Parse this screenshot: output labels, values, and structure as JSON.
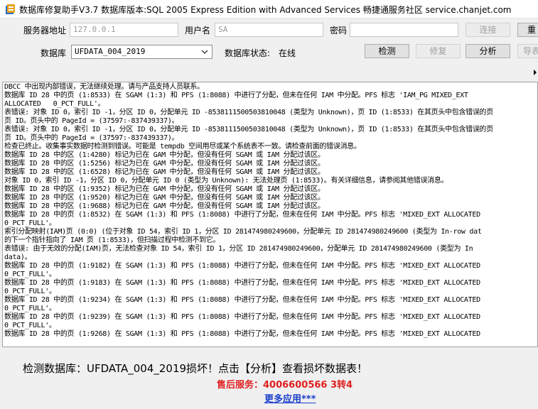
{
  "window": {
    "title": "数据库修复助手V3.7 数据库版本:SQL 2005 Express Edition with Advanced Services 畅捷通服务社区 service.chanjet.com"
  },
  "form": {
    "server_label": "服务器地址",
    "server_value": "127.0.0.1",
    "user_label": "用户名",
    "user_value": "SA",
    "password_label": "密码",
    "password_value": "",
    "database_label": "数据库",
    "database_selected": "UFDATA_004_2019",
    "db_status_label": "数据库状态:",
    "db_status_value": "在线"
  },
  "buttons": {
    "connect": "连接",
    "reconnect": "重",
    "check": "检测",
    "repair": "修复",
    "analyze": "分析",
    "export": "导表"
  },
  "log": {
    "lines": [
      "DBCC 中出现内部错误，无法继续处理。请与产品支持人员联系。",
      "数据库 ID 28 中的页 (1:8533) 在 SGAM (1:3) 和 PFS (1:8088) 中进行了分配，但未在任何 IAM 中分配。PFS 标志 'IAM_PG MIXED_EXT",
      "ALLOCATED   0_PCT_FULL'。",
      "表错误: 对象 ID 0，索引 ID -1，分区 ID 0，分配单元 ID -8538111500503810048 (类型为 Unknown)，页 ID (1:8533) 在其页头中包含错误的页",
      "页 ID。页头中的 PageId = (37597:-837439337)。",
      "表错误: 对象 ID 0，索引 ID -1，分区 ID 0，分配单元 ID -8538111500503810048 (类型为 Unknown)，页 ID (1:8533) 在其页头中包含错误的页",
      "页 ID。页头中的 PageId = (37597:-837439337)。",
      "检查已终止。收集事实数据时检测到错误。可能是 tempdb 空间用尽或某个系统表不一致。请检查前面的错误消息。",
      "数据库 ID 28 中的区 (1:4280) 标记为已在 GAM 中分配，但没有任何 SGAM 或 IAM 分配过该区。",
      "数据库 ID 28 中的区 (1:5256) 标记为已在 GAM 中分配，但没有任何 SGAM 或 IAM 分配过该区。",
      "数据库 ID 28 中的区 (1:6528) 标记为已在 GAM 中分配，但没有任何 SGAM 或 IAM 分配过该区。",
      "对象 ID 0，索引 ID -1，分区 ID 0，分配单元 ID 0 (类型为 Unknown): 无法处理页 (1:8533)。有关详细信息，请参阅其他错误消息。",
      "数据库 ID 28 中的区 (1:9352) 标记为已在 GAM 中分配，但没有任何 SGAM 或 IAM 分配过该区。",
      "数据库 ID 28 中的区 (1:9520) 标记为已在 GAM 中分配，但没有任何 SGAM 或 IAM 分配过该区。",
      "数据库 ID 28 中的区 (1:9688) 标记为已在 GAM 中分配，但没有任何 SGAM 或 IAM 分配过该区。",
      "数据库 ID 28 中的页 (1:8532) 在 SGAM (1:3) 和 PFS (1:8088) 中进行了分配，但未在任何 IAM 中分配。PFS 标志 'MIXED_EXT ALLOCATED",
      "0_PCT_FULL'。",
      "索引分配映射(IAM)页 (0:0) (位于对象 ID 54，索引 ID 1，分区 ID 281474980249600，分配单元 ID 281474980249600 (类型为 In-row dat",
      "的下一个指针指向了 IAM 页 (1:8533)，但扫描过程中检测不到它。",
      "表错误: 由于无效的分配(IAM)页，无法检查对象 ID 54，索引 ID 1，分区 ID 281474980249600，分配单元 ID 281474980249600 (类型为 In",
      "data)。",
      "数据库 ID 28 中的页 (1:9182) 在 SGAM (1:3) 和 PFS (1:8088) 中进行了分配，但未在任何 IAM 中分配。PFS 标志 'MIXED_EXT ALLOCATED",
      "0_PCT_FULL'。",
      "数据库 ID 28 中的页 (1:9183) 在 SGAM (1:3) 和 PFS (1:8088) 中进行了分配，但未在任何 IAM 中分配。PFS 标志 'MIXED_EXT ALLOCATED",
      "0_PCT_FULL'。",
      "数据库 ID 28 中的页 (1:9234) 在 SGAM (1:3) 和 PFS (1:8088) 中进行了分配，但未在任何 IAM 中分配。PFS 标志 'MIXED_EXT ALLOCATED",
      "0_PCT_FULL'。",
      "数据库 ID 28 中的页 (1:9239) 在 SGAM (1:3) 和 PFS (1:8088) 中进行了分配，但未在任何 IAM 中分配。PFS 标志 'MIXED_EXT ALLOCATED",
      "0_PCT_FULL'。",
      "数据库 ID 28 中的页 (1:9268) 在 SGAM (1:3) 和 PFS (1:8088) 中进行了分配，但未在任何 IAM 中分配。PFS 标志 'MIXED_EXT ALLOCATED"
    ]
  },
  "footer": {
    "status_message": "检测数据库：UFDATA_004_2019损坏！点击【分析】查看损坏数据表！",
    "hotline": "售后服务：4006600566 3转4",
    "more_apps": "更多应用***"
  },
  "colors": {
    "hotline": "#e02020",
    "link": "#1a3fcc",
    "window_bg": "#f0f0f0"
  },
  "icons": {
    "app": "database-repair-icon",
    "dropdown": "chevron-down-icon",
    "scroll": "scroll-right-arrow-icon"
  }
}
